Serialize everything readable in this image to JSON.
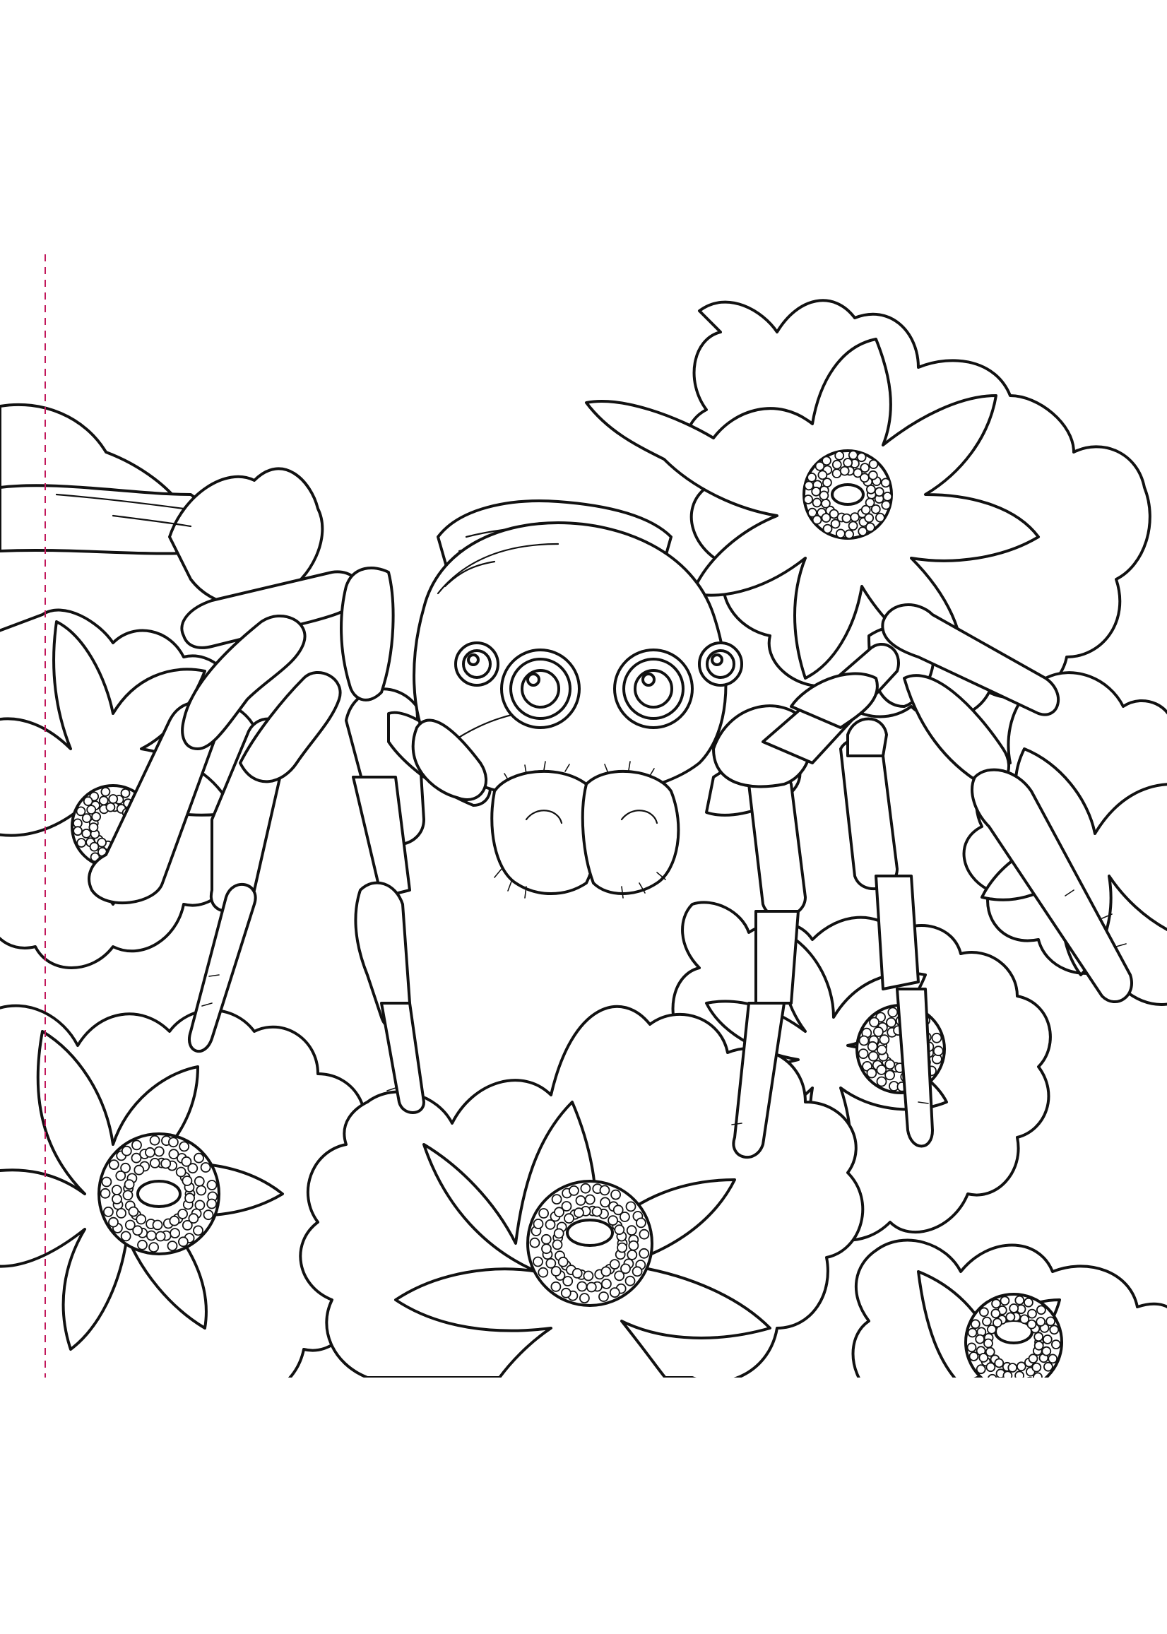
{
  "page": {
    "background_color": "#ffffff",
    "line_color": "#111111",
    "guide_color": "#c2185b"
  },
  "illustration": {
    "subject_icon": "jumping-spider-icon",
    "flower_icon": "daisy-icon"
  }
}
